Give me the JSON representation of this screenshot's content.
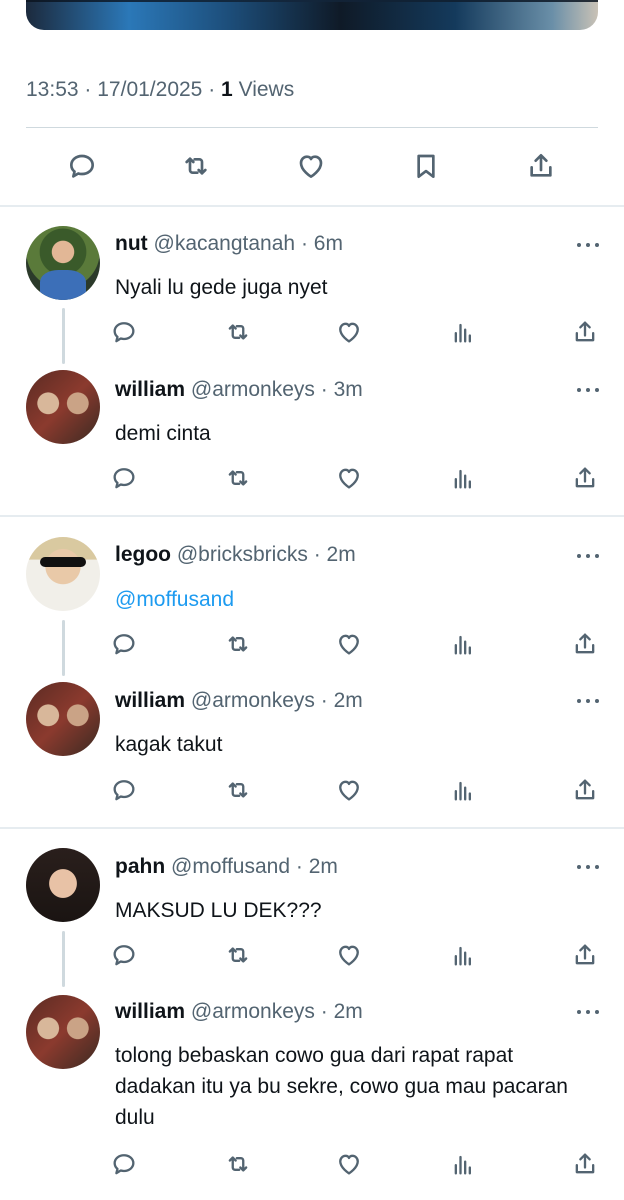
{
  "tweet": {
    "time": "13:53",
    "date": "17/01/2025",
    "views_count": "1",
    "views_label": "Views",
    "separator": "·"
  },
  "actions": [
    "reply-icon",
    "retweet-icon",
    "like-icon",
    "bookmark-icon",
    "share-icon"
  ],
  "replies": [
    {
      "name": "nut",
      "handle": "@kacangtanah",
      "time": "6m",
      "text": "Nyali lu gede juga nyet",
      "mention": false
    },
    {
      "name": "william",
      "handle": "@armonkeys",
      "time": "3m",
      "text": "demi cinta",
      "mention": false
    },
    {
      "name": "legoo",
      "handle": "@bricksbricks",
      "time": "2m",
      "text": "@moffusand",
      "mention": true
    },
    {
      "name": "william",
      "handle": "@armonkeys",
      "time": "2m",
      "text": "kagak takut",
      "mention": false
    },
    {
      "name": "pahn",
      "handle": "@moffusand",
      "time": "2m",
      "text": "MAKSUD LU DEK???",
      "mention": false
    },
    {
      "name": "william",
      "handle": "@armonkeys",
      "time": "2m",
      "text": "tolong bebaskan cowo gua dari rapat rapat dadakan itu ya bu sekre, cowo gua mau pacaran dulu",
      "mention": false
    }
  ],
  "colors": {
    "accent": "#1d9bf0",
    "icon": "#536471",
    "divider": "#cfd9de"
  }
}
